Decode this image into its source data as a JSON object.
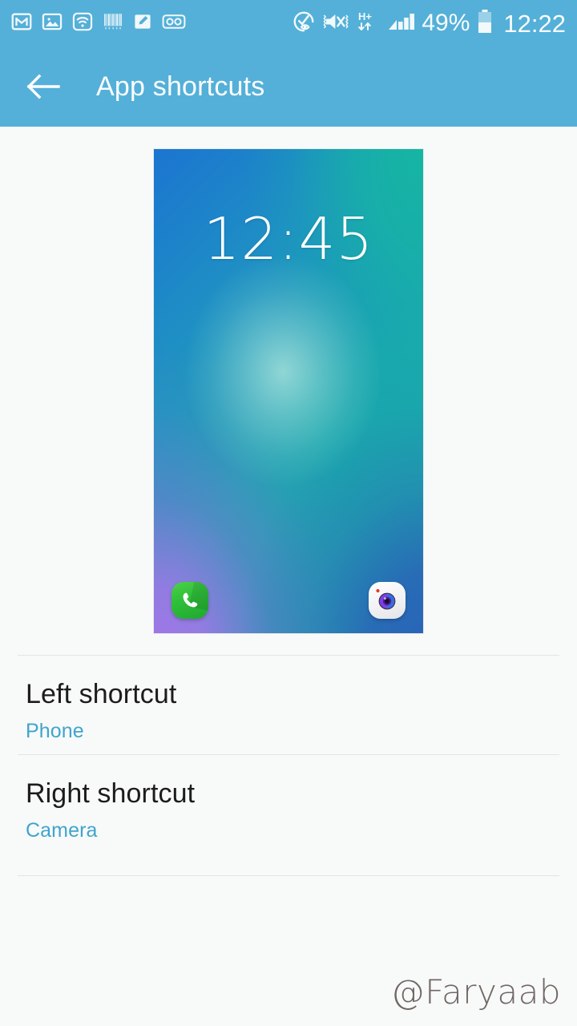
{
  "status_bar": {
    "background_color": "#54b0d8",
    "left_icons": [
      {
        "name": "gmail-icon",
        "label": "Gmail"
      },
      {
        "name": "gallery-image-icon",
        "label": "Gallery"
      },
      {
        "name": "wifi-icon",
        "label": "Wi-Fi"
      },
      {
        "name": "barcode-icon",
        "label": "Barcode"
      },
      {
        "name": "edit-note-icon",
        "label": "Note"
      },
      {
        "name": "voicemail-icon",
        "label": "Voicemail"
      }
    ],
    "right_icons": [
      {
        "name": "smart-stay-eye-icon",
        "label": "Smart stay"
      },
      {
        "name": "mute-vibrate-icon",
        "label": "Sound off / vibrate"
      },
      {
        "name": "hsplus-network-icon",
        "label": "H+"
      },
      {
        "name": "signal-bars-icon",
        "label": "Signal"
      },
      {
        "name": "battery-icon",
        "label": "Battery"
      }
    ],
    "network_type": "H+",
    "battery_percent": "49%",
    "clock": "12:22"
  },
  "app_bar": {
    "back_label": "Back",
    "title": "App shortcuts",
    "background_color": "#54b0d8",
    "title_color": "#ffffff"
  },
  "preview": {
    "name": "lockscreen-preview",
    "clock": "12:45",
    "wallpaper_colors": {
      "top_left": "#1b75d0",
      "top_right": "#17b4a4",
      "bottom_left": "#a774ea",
      "bottom_right": "#2a62b8",
      "center_glow": "#bde9e0"
    },
    "left_icon": {
      "name": "phone-icon",
      "label": "Phone",
      "color": "#2fc03a"
    },
    "right_icon": {
      "name": "camera-icon",
      "label": "Camera",
      "color": "#7b3fe4"
    }
  },
  "list": {
    "items": [
      {
        "title": "Left shortcut",
        "value": "Phone"
      },
      {
        "title": "Right shortcut",
        "value": "Camera"
      }
    ]
  },
  "watermark": {
    "text": "@Faryaab",
    "color": "#5e534e"
  }
}
